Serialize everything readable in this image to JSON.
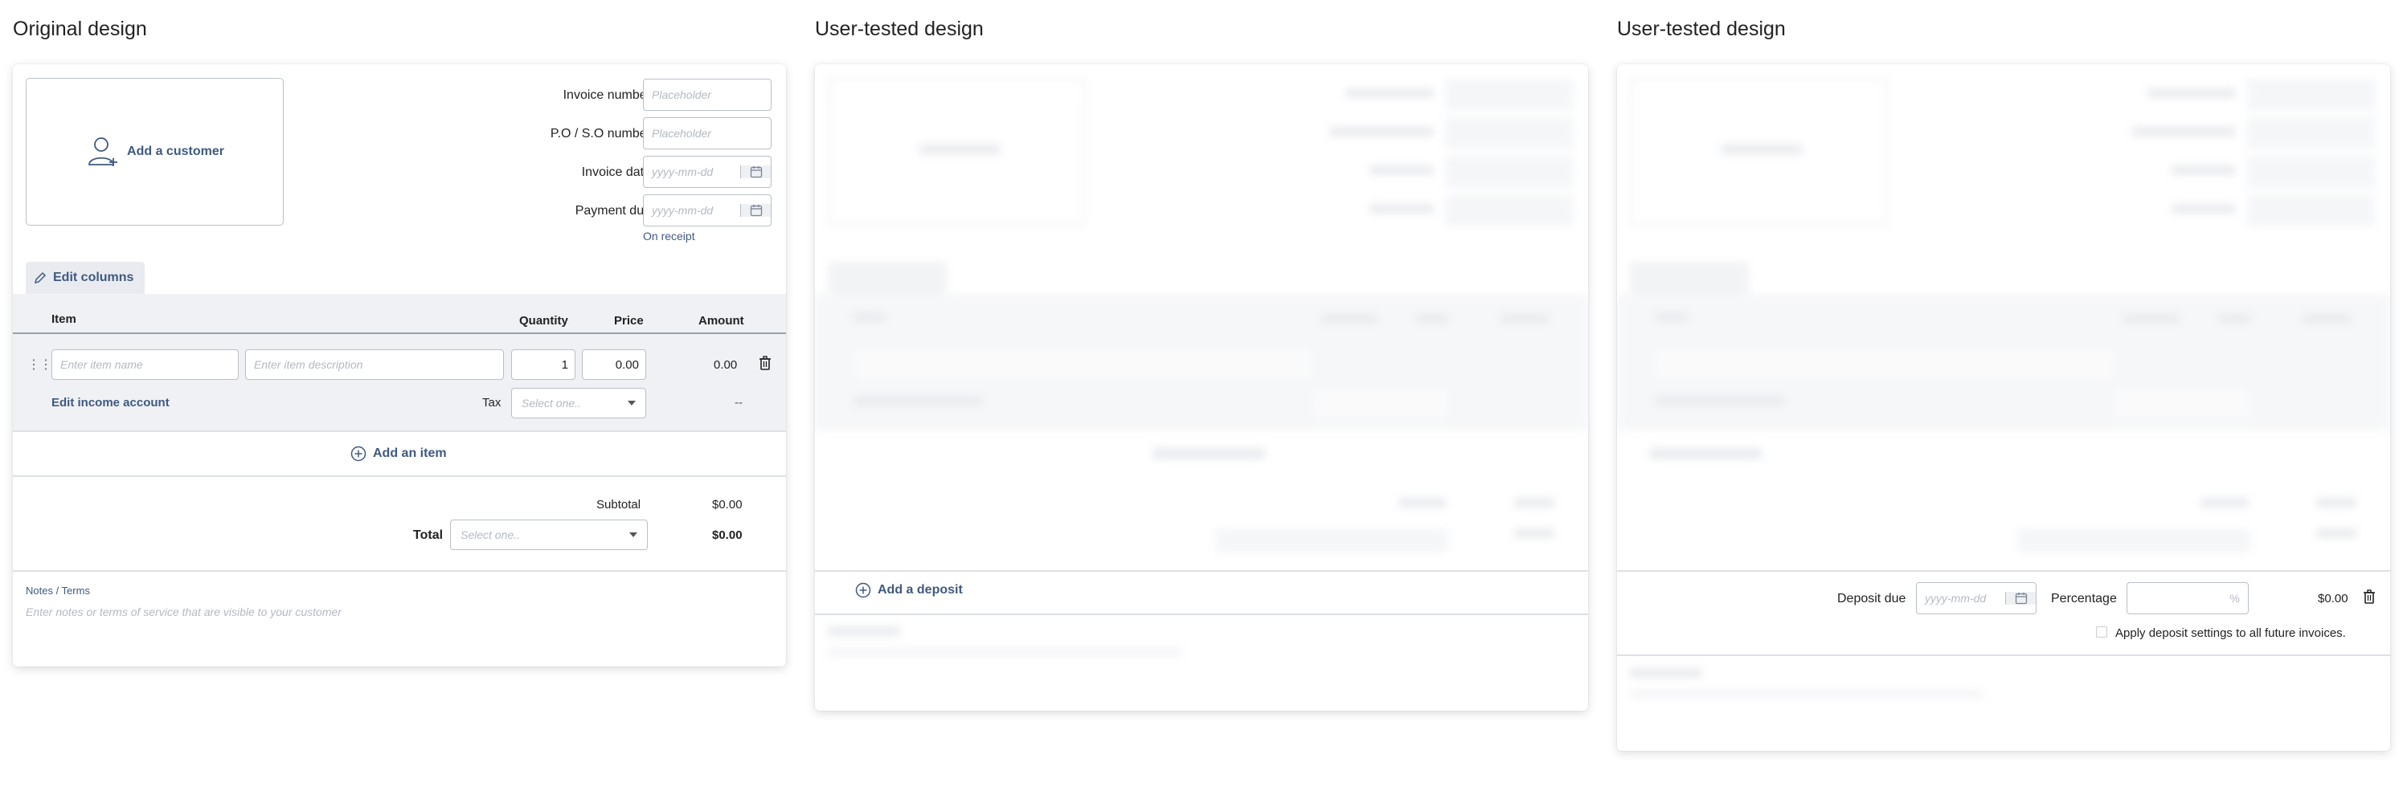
{
  "headings": {
    "original": "Original design",
    "tested_a": "User-tested design",
    "tested_b": "User-tested design"
  },
  "invoice": {
    "add_customer": "Add a customer",
    "invoice_number_label": "Invoice number",
    "invoice_number_placeholder": "Placeholder",
    "po_label": "P.O / S.O number",
    "po_placeholder": "Placeholder",
    "invoice_date_label": "Invoice date",
    "invoice_date_placeholder": "yyyy-mm-dd",
    "payment_due_label": "Payment due",
    "payment_due_placeholder": "yyyy-mm-dd",
    "on_receipt": "On receipt",
    "edit_columns": "Edit columns",
    "columns": {
      "item": "Item",
      "quantity": "Quantity",
      "price": "Price",
      "amount": "Amount"
    },
    "row": {
      "item_name_placeholder": "Enter item name",
      "item_desc_placeholder": "Enter item description",
      "quantity": "1",
      "price": "0.00",
      "amount": "0.00",
      "edit_income": "Edit income account",
      "tax_label": "Tax",
      "tax_placeholder": "Select one..",
      "tax_amount": "--"
    },
    "add_item": "Add an item",
    "subtotal_label": "Subtotal",
    "subtotal_value": "$0.00",
    "total_label": "Total",
    "total_select_placeholder": "Select one..",
    "total_value": "$0.00",
    "notes_label": "Notes / Terms",
    "notes_placeholder": "Enter notes or terms of service that are visible to your customer"
  },
  "deposit_a": {
    "add_deposit": "Add a deposit"
  },
  "deposit_b": {
    "deposit_due_label": "Deposit due",
    "deposit_due_placeholder": "yyyy-mm-dd",
    "percentage_label": "Percentage",
    "percentage_unit": "%",
    "amount": "$0.00",
    "apply_all": "Apply deposit settings to all future invoices."
  }
}
